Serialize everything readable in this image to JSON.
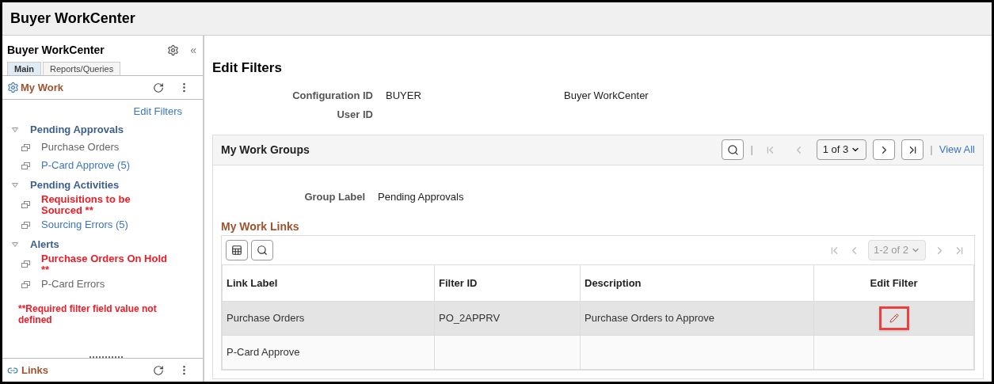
{
  "header": {
    "title": "Buyer WorkCenter"
  },
  "sidebar": {
    "title": "Buyer WorkCenter",
    "collapse": "«",
    "tabs": [
      {
        "label": "Main",
        "selected": true
      },
      {
        "label": "Reports/Queries",
        "selected": false
      }
    ],
    "my_work": {
      "title": "My Work",
      "edit_filters": "Edit Filters",
      "groups": [
        {
          "label": "Pending Approvals",
          "expanded": true,
          "children": [
            {
              "label": "Purchase Orders",
              "kind": "plain"
            },
            {
              "label": "P-Card Approve (5)",
              "kind": "link"
            }
          ]
        },
        {
          "label": "Pending Activities",
          "expanded": true,
          "children": [
            {
              "label": "Requisitions to be Sourced **",
              "kind": "required"
            },
            {
              "label": "Sourcing Errors (5)",
              "kind": "link"
            }
          ]
        },
        {
          "label": "Alerts",
          "expanded": true,
          "children": [
            {
              "label": "Purchase Orders On Hold **",
              "kind": "required"
            },
            {
              "label": "P-Card Errors",
              "kind": "plain"
            }
          ]
        }
      ],
      "note": "**Required filter field value not defined"
    },
    "links": {
      "title": "Links"
    }
  },
  "main": {
    "title": "Edit Filters",
    "fields": [
      {
        "label": "Configuration ID",
        "value": "BUYER",
        "description": "Buyer WorkCenter"
      },
      {
        "label": "User ID"
      }
    ],
    "groups_panel": {
      "title": "My Work Groups",
      "pager": "1 of 3",
      "view_all": "View All",
      "separator": "|",
      "group_label": {
        "label": "Group Label",
        "value": "Pending Approvals"
      },
      "links_title": "My Work Links",
      "grid": {
        "pager": "1-2 of 2",
        "columns": [
          "Link Label",
          "Filter ID",
          "Description",
          "Edit Filter"
        ],
        "rows": [
          {
            "link_label": "Purchase Orders",
            "filter_id": "PO_2APPRV",
            "description": "Purchase Orders to Approve",
            "editable": true,
            "highlighted": true,
            "selected": true
          },
          {
            "link_label": "P-Card Approve",
            "editable": false,
            "selected": false
          }
        ]
      }
    }
  }
}
